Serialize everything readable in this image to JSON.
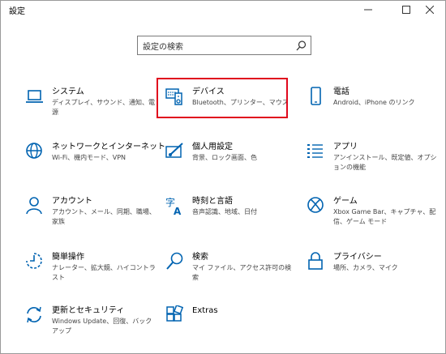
{
  "window": {
    "title": "設定"
  },
  "search": {
    "placeholder": "設定の検索"
  },
  "tiles": [
    {
      "name": "システム",
      "desc": "ディスプレイ、サウンド、通知、電源"
    },
    {
      "name": "デバイス",
      "desc": "Bluetooth、プリンター、マウス"
    },
    {
      "name": "電話",
      "desc": "Android、iPhone のリンク"
    },
    {
      "name": "ネットワークとインターネット",
      "desc": "Wi-Fi、機内モード、VPN"
    },
    {
      "name": "個人用設定",
      "desc": "背景、ロック画面、色"
    },
    {
      "name": "アプリ",
      "desc": "アンインストール、既定値、オプションの機能"
    },
    {
      "name": "アカウント",
      "desc": "アカウント、メール、同期、職場、家族"
    },
    {
      "name": "時刻と言語",
      "desc": "音声認識、地域、日付"
    },
    {
      "name": "ゲーム",
      "desc": "Xbox Game Bar、キャプチャ、配信、ゲーム モード"
    },
    {
      "name": "簡単操作",
      "desc": "ナレーター、拡大鏡、ハイコントラスト"
    },
    {
      "name": "検索",
      "desc": "マイ ファイル、アクセス許可の検索"
    },
    {
      "name": "プライバシー",
      "desc": "場所、カメラ、マイク"
    },
    {
      "name": "更新とセキュリティ",
      "desc": "Windows Update、回復、バックアップ"
    },
    {
      "name": "Extras",
      "desc": ""
    }
  ],
  "colors": {
    "accent": "#0063b1",
    "highlight": "#e0081d"
  }
}
